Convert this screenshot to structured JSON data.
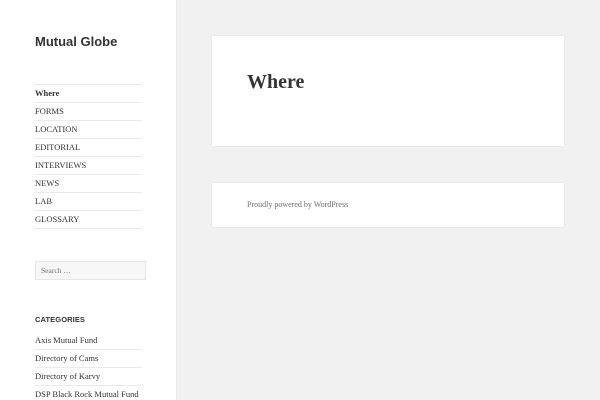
{
  "site": {
    "title": "Mutual Globe"
  },
  "nav": {
    "items": [
      {
        "label": "Where"
      },
      {
        "label": "FORMS"
      },
      {
        "label": "LOCATION"
      },
      {
        "label": "EDITORIAL"
      },
      {
        "label": "INTERVIEWS"
      },
      {
        "label": "NEWS"
      },
      {
        "label": "LAB"
      },
      {
        "label": "GLOSSARY"
      }
    ],
    "current": "Where"
  },
  "search": {
    "placeholder": "Search …"
  },
  "categories": {
    "title": "CATEGORIES",
    "items": [
      {
        "label": "Axis Mutual Fund"
      },
      {
        "label": "Directory of Cams"
      },
      {
        "label": "Directory of Karvy"
      },
      {
        "label": "DSP Black Rock Mutual Fund"
      }
    ]
  },
  "main": {
    "heading": "Where"
  },
  "footer": {
    "credit": "Proudly powered by WordPress"
  },
  "colors": {
    "background": "#f1f1f1",
    "panel": "#ffffff",
    "text": "#333333",
    "muted": "#707070",
    "divider": "#eaeaea"
  }
}
